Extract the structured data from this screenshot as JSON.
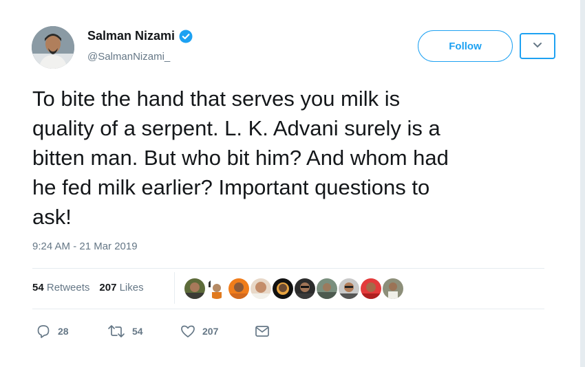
{
  "user": {
    "name": "Salman Nizami",
    "handle": "@SalmanNizami_",
    "verified": true
  },
  "header": {
    "follow_label": "Follow",
    "menu_icon": "chevron-down-icon"
  },
  "tweet": {
    "text": "To bite the hand that serves you milk is\nquality of a serpent. L. K. Advani surely is a\nbitten man. But who bit him? And whom had\nhe fed milk earlier? Important questions to\nask!",
    "timestamp": "9:24 AM - 21 Mar 2019"
  },
  "stats": {
    "retweets_count": "54",
    "retweets_label": "Retweets",
    "likes_count": "207",
    "likes_label": "Likes"
  },
  "likers": [
    "avatar",
    "avatar",
    "avatar",
    "avatar",
    "avatar",
    "avatar",
    "avatar",
    "avatar",
    "avatar",
    "avatar"
  ],
  "actions": {
    "reply_count": "28",
    "retweet_count": "54",
    "like_count": "207"
  },
  "colors": {
    "accent": "#1da1f2",
    "muted": "#657786",
    "text": "#14171a"
  }
}
